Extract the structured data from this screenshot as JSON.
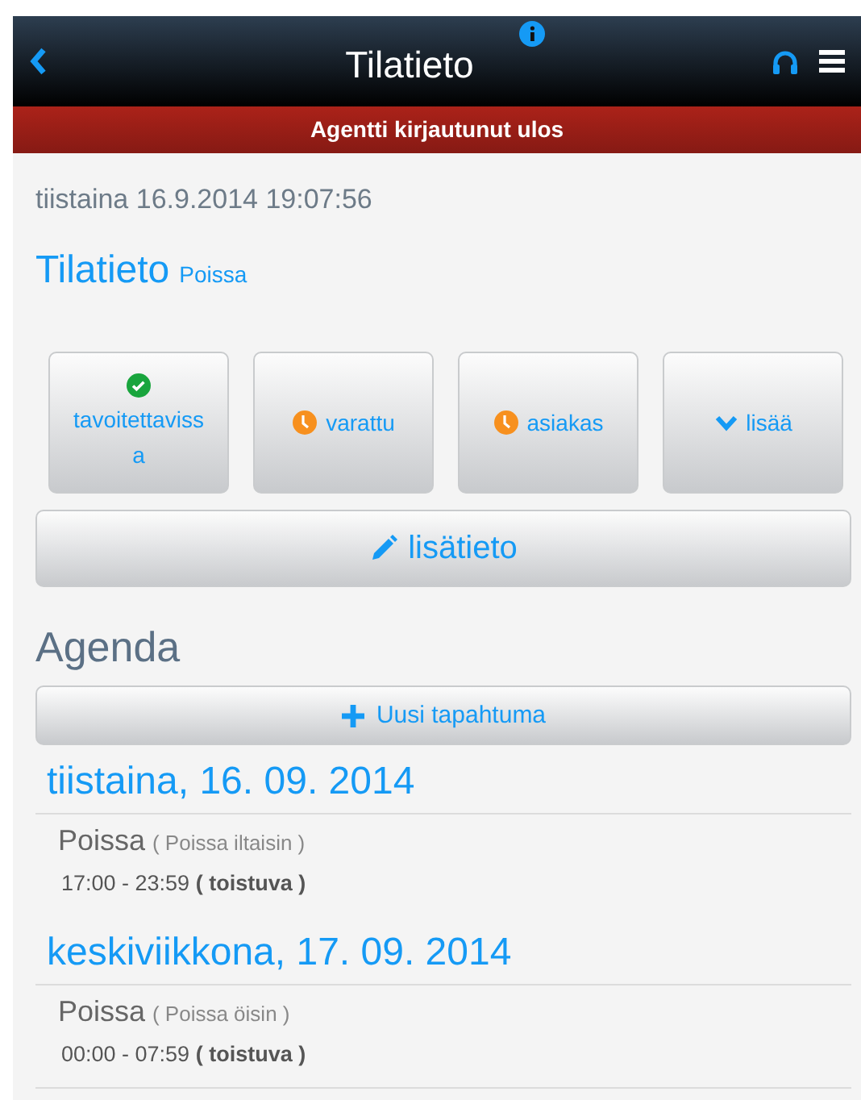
{
  "header": {
    "title": "Tilatieto"
  },
  "banner": "Agentti kirjautunut ulos",
  "timestamp": "tiistaina 16.9.2014 19:07:56",
  "status": {
    "title": "Tilatieto",
    "value": "Poissa"
  },
  "status_buttons": [
    {
      "label": "tavoitettavissa",
      "kind": "check"
    },
    {
      "label": "varattu",
      "kind": "clock"
    },
    {
      "label": "asiakas",
      "kind": "clock"
    },
    {
      "label": "lisää",
      "kind": "more"
    }
  ],
  "note_button": "lisätieto",
  "agenda": {
    "title": "Agenda",
    "new_button": "Uusi tapahtuma",
    "days": [
      {
        "date": "tiistaina, 16. 09. 2014",
        "events": [
          {
            "type": "Poissa",
            "note": "( Poissa iltaisin )",
            "time": "17:00 - 23:59",
            "repeat": "( toistuva )"
          }
        ]
      },
      {
        "date": "keskiviikkona, 17. 09. 2014",
        "events": [
          {
            "type": "Poissa",
            "note": "( Poissa öisin )",
            "time": "00:00 - 07:59",
            "repeat": "( toistuva )"
          }
        ]
      }
    ]
  }
}
